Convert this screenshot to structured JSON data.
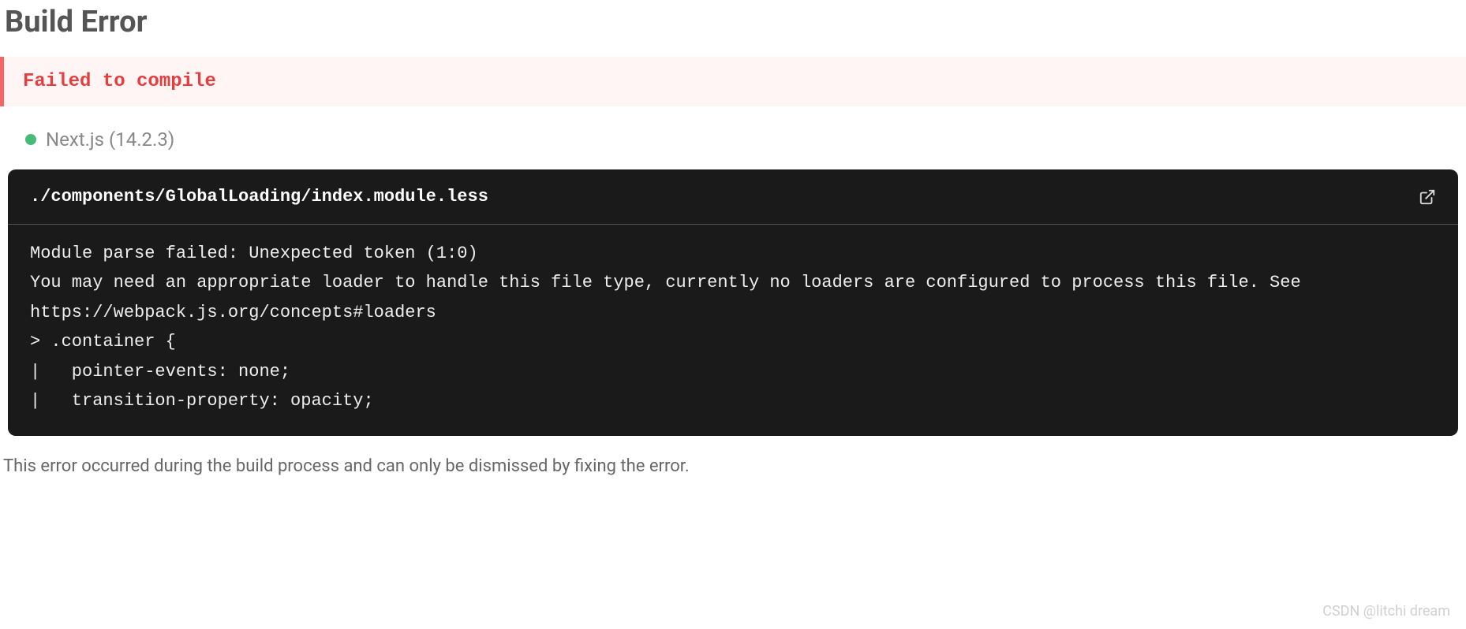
{
  "title": "Build Error",
  "banner": {
    "message": "Failed to compile"
  },
  "framework": {
    "label": "Next.js (14.2.3)"
  },
  "code": {
    "file_path": "./components/GlobalLoading/index.module.less",
    "body": "Module parse failed: Unexpected token (1:0)\nYou may need an appropriate loader to handle this file type, currently no loaders are configured to process this file. See https://webpack.js.org/concepts#loaders\n> .container {\n|   pointer-events: none;\n|   transition-property: opacity;"
  },
  "footer": "This error occurred during the build process and can only be dismissed by fixing the error.",
  "watermark": "CSDN @litchi dream"
}
